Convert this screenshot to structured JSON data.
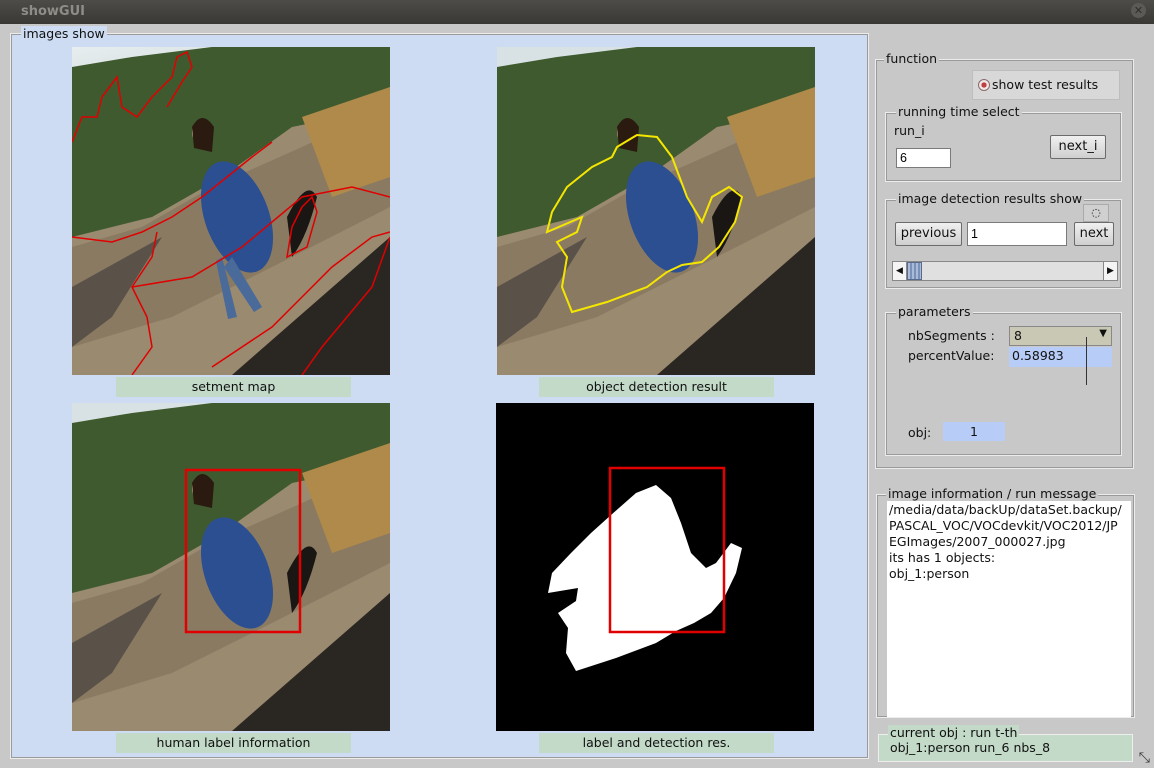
{
  "window": {
    "title": "showGUI"
  },
  "images_panel": {
    "label": "images show",
    "captions": [
      "setment map",
      "object detection result",
      "human label information",
      "label and detection res."
    ]
  },
  "function_panel": {
    "label": "function",
    "show_test_results": "show test results",
    "running_time": {
      "label": "running time select",
      "run_label": "run_i",
      "run_value": "6",
      "next_label": "next_i"
    },
    "detection": {
      "label": "image detection results show",
      "previous_label": "previous",
      "index_value": "1",
      "next_label": "next"
    },
    "parameters": {
      "label": "parameters",
      "nb_segments_label": "nbSegments :",
      "nb_segments_value": "8",
      "percent_label": "percentValue:",
      "percent_value": "0.58983",
      "obj_label": "obj:",
      "obj_value": "1"
    }
  },
  "info_panel": {
    "label": "image information / run message",
    "lines": [
      "/media/data/backUp/dataSet.backup/",
      "PASCAL_VOC/VOCdevkit/VOC2012/JP",
      "EGImages/2007_000027.jpg",
      "its has 1 objects:",
      "obj_1:person"
    ]
  },
  "current_obj": {
    "label": "current obj : run t-th",
    "value": "obj_1:person  run_6  nbs_8"
  },
  "colors": {
    "panel_bg": "#cddcf2",
    "caption_bg": "#c2dac7",
    "segment_line": "#e00000",
    "detection_line": "#f5e600",
    "highlight": "#b8ccf8"
  }
}
